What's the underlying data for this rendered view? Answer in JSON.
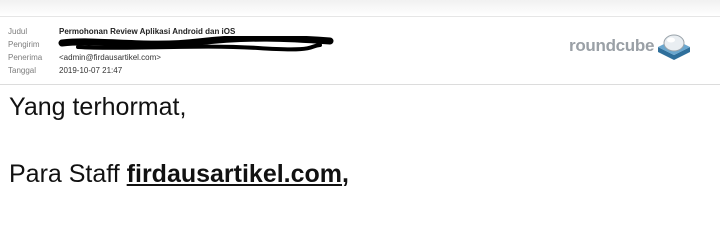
{
  "header": {
    "subject_label": "Judul",
    "subject_value": "Permohonan Review Aplikasi Android dan iOS",
    "from_label": "Pengirim",
    "to_label": "Penerima",
    "to_value": "<admin@firdausartikel.com>",
    "date_label": "Tanggal",
    "date_value": "2019-10-07 21:47"
  },
  "logo": {
    "text": "roundcube",
    "icon": "roundcube-cube-icon"
  },
  "body": {
    "greeting": "Yang terhormat,",
    "staff_prefix": "Para Staff ",
    "staff_link": "firdausartikel.com",
    "staff_suffix": ","
  }
}
